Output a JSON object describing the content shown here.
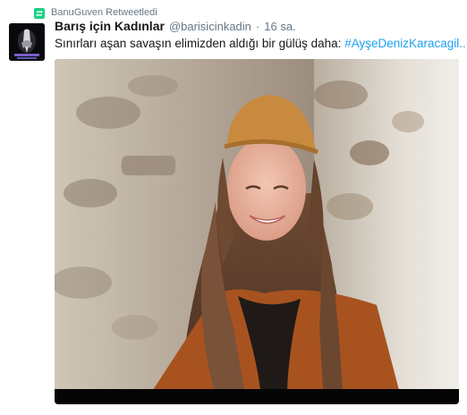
{
  "retweet_context": {
    "text": "BanuGuven Retweetledi",
    "icon": "retweet-icon",
    "icon_color": "#19cf86"
  },
  "tweet": {
    "display_name": "Barış için Kadınlar",
    "screen_name": "@barisicinkadin",
    "separator": "·",
    "timestamp": "16 sa.",
    "text": "Sınırları aşan savaşın elimizden aldığı bir gülüş daha: ",
    "hashtag": "#AyşeDenizKaracagil",
    "ellipsis": "..",
    "hashtag_color": "#1da1f2"
  },
  "media": {
    "type": "photo",
    "icon": "photo-image"
  }
}
